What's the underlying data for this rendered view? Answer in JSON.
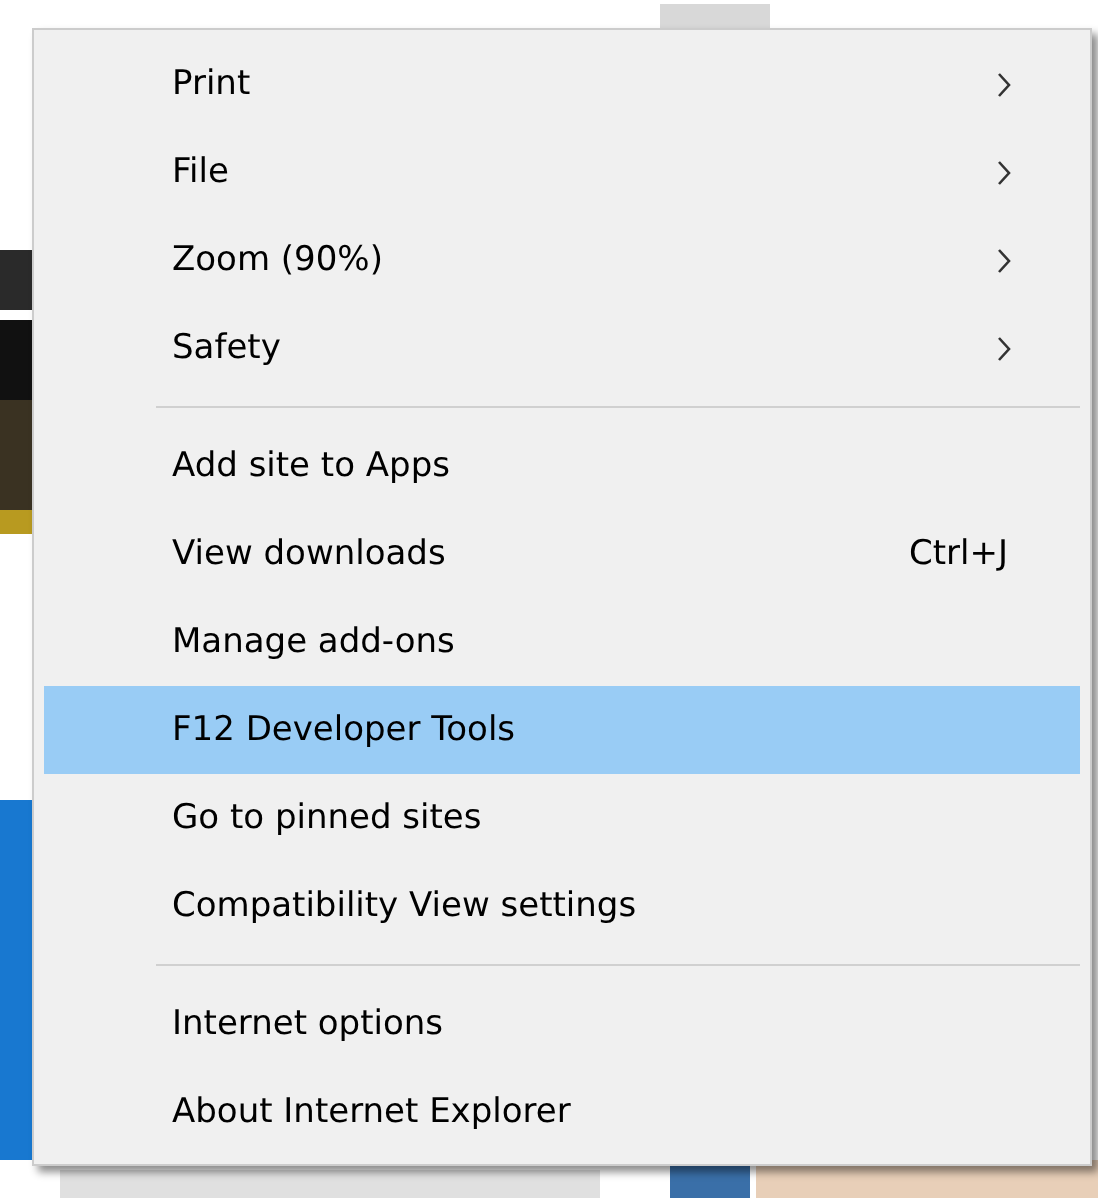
{
  "menu": {
    "groups": [
      {
        "items": [
          {
            "label": "Print",
            "kind": "submenu",
            "selected": false
          },
          {
            "label": "File",
            "kind": "submenu",
            "selected": false
          },
          {
            "label": "Zoom (90%)",
            "kind": "submenu",
            "selected": false
          },
          {
            "label": "Safety",
            "kind": "submenu",
            "selected": false
          }
        ]
      },
      {
        "items": [
          {
            "label": "Add site to Apps",
            "kind": "command",
            "selected": false
          },
          {
            "label": "View downloads",
            "kind": "command",
            "shortcut": "Ctrl+J",
            "selected": false
          },
          {
            "label": "Manage add-ons",
            "kind": "command",
            "selected": false
          },
          {
            "label": "F12 Developer Tools",
            "kind": "command",
            "selected": true
          },
          {
            "label": "Go to pinned sites",
            "kind": "command",
            "selected": false
          },
          {
            "label": "Compatibility View settings",
            "kind": "command",
            "selected": false
          }
        ]
      },
      {
        "items": [
          {
            "label": "Internet options",
            "kind": "command",
            "selected": false
          },
          {
            "label": "About Internet Explorer",
            "kind": "command",
            "selected": false
          }
        ]
      }
    ]
  }
}
